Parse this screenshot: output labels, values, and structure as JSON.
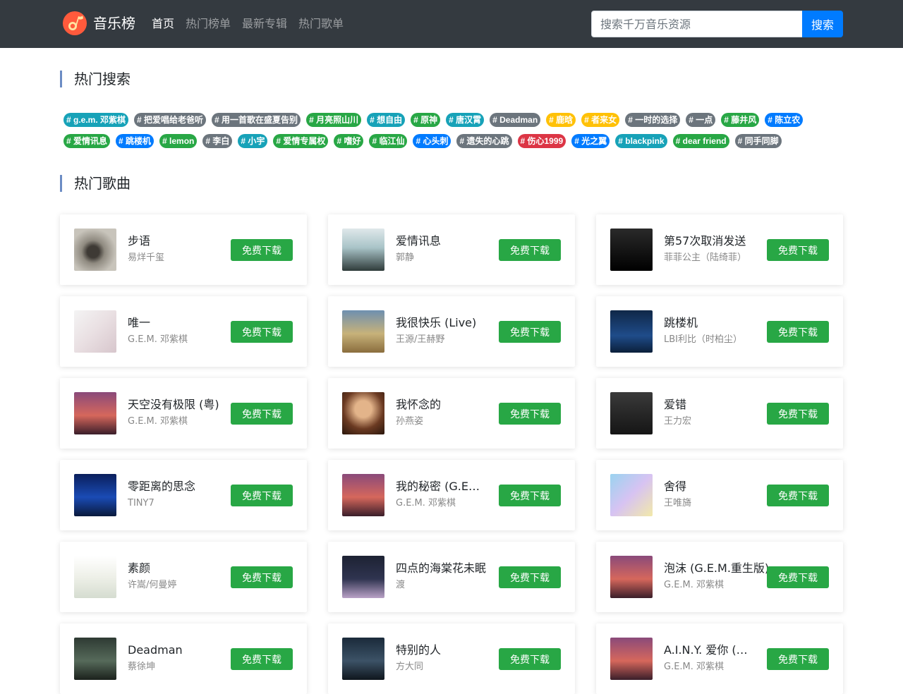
{
  "navbar": {
    "brand": "音乐榜",
    "logo_icon": "music-note-icon",
    "links": [
      "首页",
      "热门榜单",
      "最新专辑",
      "热门歌单"
    ],
    "active_link": "首页",
    "search_placeholder": "搜索千万音乐资源",
    "search_button": "搜索",
    "colors": {
      "bar": "#343a40",
      "search_button": "#007bff",
      "logo": "#ff5a3c"
    }
  },
  "hot_search": {
    "title": "热门搜索",
    "tag_rows": [
      [
        {
          "label": "# g.e.m. 邓紫棋",
          "color": "#17a2b8"
        },
        {
          "label": "# 把爱唱给老爸听",
          "color": "#6c757d"
        },
        {
          "label": "# 用一首歌在盛夏告别",
          "color": "#6c757d"
        },
        {
          "label": "# 月亮照山川",
          "color": "#28a745"
        },
        {
          "label": "# 想自由",
          "color": "#17a2b8"
        },
        {
          "label": "# 原神",
          "color": "#28a745"
        },
        {
          "label": "# 唐汉霄",
          "color": "#17a2b8"
        },
        {
          "label": "# Deadman",
          "color": "#6c757d"
        },
        {
          "label": "# 鹿晗",
          "color": "#ffc107"
        },
        {
          "label": "# 者来女",
          "color": "#ffc107"
        },
        {
          "label": "# 一时的选择",
          "color": "#6c757d"
        },
        {
          "label": "# 一点",
          "color": "#6c757d"
        },
        {
          "label": "# 藤井风",
          "color": "#28a745"
        },
        {
          "label": "# 陈立农",
          "color": "#007bff"
        }
      ],
      [
        {
          "label": "# 爱情讯息",
          "color": "#28a745"
        },
        {
          "label": "# 跳楼机",
          "color": "#007bff"
        },
        {
          "label": "# lemon",
          "color": "#28a745"
        },
        {
          "label": "# 李白",
          "color": "#6c757d"
        },
        {
          "label": "# 小宇",
          "color": "#17a2b8"
        },
        {
          "label": "# 爱情专属权",
          "color": "#28a745"
        },
        {
          "label": "# 嗜好",
          "color": "#28a745"
        },
        {
          "label": "# 临江仙",
          "color": "#28a745"
        },
        {
          "label": "# 心头刺",
          "color": "#007bff"
        },
        {
          "label": "# 遗失的心跳",
          "color": "#6c757d"
        },
        {
          "label": "# 伤心1999",
          "color": "#dc3545"
        },
        {
          "label": "# 光之翼",
          "color": "#007bff"
        },
        {
          "label": "# blackpink",
          "color": "#17a2b8"
        },
        {
          "label": "# dear friend",
          "color": "#28a745"
        },
        {
          "label": "# 同手同脚",
          "color": "#6c757d"
        }
      ]
    ]
  },
  "hot_songs": {
    "title": "热门歌曲",
    "download_label": "免费下载",
    "songs": [
      {
        "name": "步语",
        "artist": "易烊千玺",
        "cover": "cover-art"
      },
      {
        "name": "爱情讯息",
        "artist": "郭静",
        "cover": "cover-art"
      },
      {
        "name": "第57次取消发送",
        "artist": "菲菲公主（陆绮菲）",
        "cover": "cover-art"
      },
      {
        "name": "唯一",
        "artist": "G.E.M. 邓紫棋",
        "cover": "cover-art"
      },
      {
        "name": "我很快乐 (Live)",
        "artist": "王源/王赫野",
        "cover": "cover-art"
      },
      {
        "name": "跳楼机",
        "artist": "LBI利比（时柏尘）",
        "cover": "cover-art"
      },
      {
        "name": "天空没有极限 (粤)",
        "artist": "G.E.M. 邓紫棋",
        "cover": "cover-art"
      },
      {
        "name": "我怀念的",
        "artist": "孙燕姿",
        "cover": "cover-art"
      },
      {
        "name": "爱错",
        "artist": "王力宏",
        "cover": "cover-art"
      },
      {
        "name": "零距离的思念",
        "artist": "TINY7",
        "cover": "cover-art"
      },
      {
        "name": "我的秘密 (G.E.M.重生版)",
        "artist": "G.E.M. 邓紫棋",
        "cover": "cover-art"
      },
      {
        "name": "舍得",
        "artist": "王唯旖",
        "cover": "cover-art"
      },
      {
        "name": "素颜",
        "artist": "许嵩/何曼婷",
        "cover": "cover-art"
      },
      {
        "name": "四点的海棠花未眠",
        "artist": "渡",
        "cover": "cover-art"
      },
      {
        "name": "泡沫 (G.E.M.重生版)",
        "artist": "G.E.M. 邓紫棋",
        "cover": "cover-art"
      },
      {
        "name": "Deadman",
        "artist": "蔡徐坤",
        "cover": "cover-art"
      },
      {
        "name": "特别的人",
        "artist": "方大同",
        "cover": "cover-art"
      },
      {
        "name": "A.I.N.Y. 爱你 (G.E.M.重生版)",
        "artist": "G.E.M. 邓紫棋",
        "cover": "cover-art"
      }
    ],
    "colors": {
      "download_button": "#28a745"
    }
  }
}
